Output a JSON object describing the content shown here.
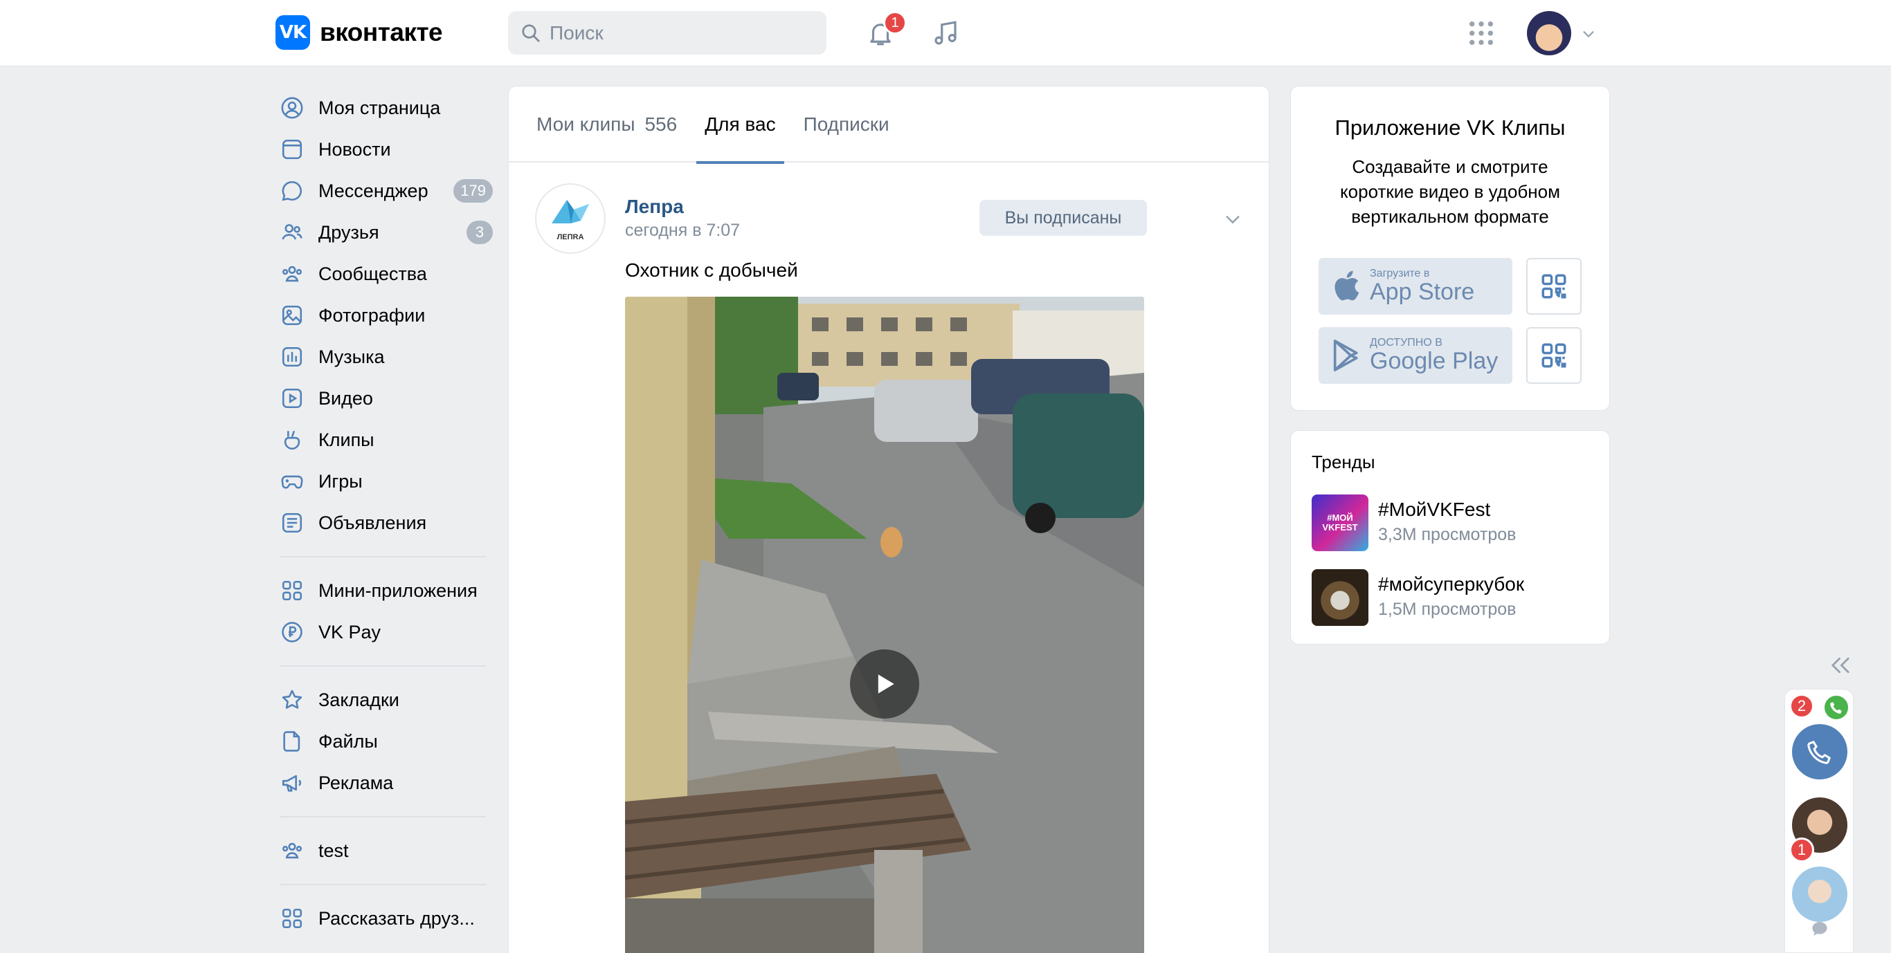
{
  "header": {
    "logo_mark": "VK",
    "logo_text": "вконтакте",
    "search_placeholder": "Поиск",
    "notifications_count": "1"
  },
  "nav": {
    "items": [
      {
        "label": "Моя страница",
        "icon": "user-circle-icon"
      },
      {
        "label": "Новости",
        "icon": "news-icon"
      },
      {
        "label": "Мессенджер",
        "icon": "message-icon",
        "badge": "179"
      },
      {
        "label": "Друзья",
        "icon": "friends-icon",
        "badge": "3"
      },
      {
        "label": "Сообщества",
        "icon": "communities-icon"
      },
      {
        "label": "Фотографии",
        "icon": "photo-icon"
      },
      {
        "label": "Музыка",
        "icon": "music-icon"
      },
      {
        "label": "Видео",
        "icon": "video-icon"
      },
      {
        "label": "Клипы",
        "icon": "clips-icon"
      },
      {
        "label": "Игры",
        "icon": "gamepad-icon"
      },
      {
        "label": "Объявления",
        "icon": "ads-icon"
      }
    ],
    "group2": [
      {
        "label": "Мини-приложения",
        "icon": "apps-icon"
      },
      {
        "label": "VK Pay",
        "icon": "pay-icon"
      }
    ],
    "group3": [
      {
        "label": "Закладки",
        "icon": "star-icon"
      },
      {
        "label": "Файлы",
        "icon": "file-icon"
      },
      {
        "label": "Реклама",
        "icon": "megaphone-icon"
      }
    ],
    "group4": [
      {
        "label": "test",
        "icon": "group-icon"
      }
    ],
    "group5": [
      {
        "label": "Рассказать друз...",
        "icon": "apps-icon"
      }
    ]
  },
  "clips": {
    "tabs": [
      {
        "label": "Мои клипы",
        "count": "556"
      },
      {
        "label": "Для вас"
      },
      {
        "label": "Подписки"
      }
    ],
    "active_tab": "Для вас",
    "post": {
      "group_name": "Лепра",
      "group_logo_text": "ЛЕПRA",
      "date": "сегодня в 7:07",
      "subscribe_label": "Вы подписаны",
      "text": "Охотник с добычей"
    }
  },
  "app_promo": {
    "title": "Приложение VK Клипы",
    "description": "Создавайте и смотрите короткие видео в удобном вертикальном формате",
    "appstore_small": "Загрузите в",
    "appstore_big": "App Store",
    "gplay_small": "ДОСТУПНО В",
    "gplay_big": "Google Play"
  },
  "trends": {
    "title": "Тренды",
    "items": [
      {
        "name": "#МойVKFest",
        "views": "3,3M просмотров",
        "thumb_text": "#МОЙ VKFEST"
      },
      {
        "name": "#мойсуперкубок",
        "views": "1,5M просмотров"
      }
    ]
  },
  "chatbar": {
    "call_badge": "2",
    "chat2_badge": "1"
  },
  "colors": {
    "accent": "#0077ff",
    "link": "#2a5885",
    "badge_red": "#e64646",
    "background": "#edeef0"
  }
}
